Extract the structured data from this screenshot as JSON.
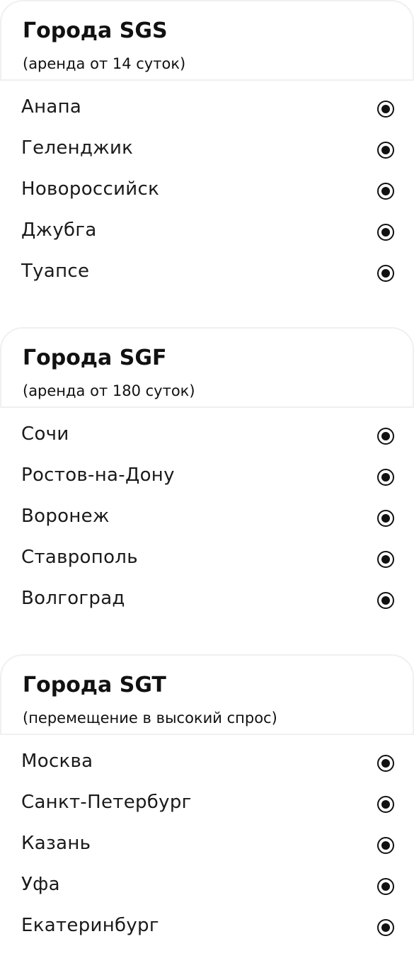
{
  "sections": [
    {
      "title": "Города SGS",
      "subtitle": "(аренда от 14 суток)",
      "cities": [
        "Анапа",
        "Геленджик",
        "Новороссийск",
        "Джубга",
        "Туапсе"
      ]
    },
    {
      "title": "Города SGF",
      "subtitle": "(аренда от 180 суток)",
      "cities": [
        "Сочи",
        "Ростов-на-Дону",
        "Воронеж",
        "Ставрополь",
        "Волгоград"
      ]
    },
    {
      "title": "Города SGT",
      "subtitle": "(перемещение в высокий спрос)",
      "cities": [
        "Москва",
        "Санкт-Петербург",
        "Казань",
        "Уфа",
        "Екатеринбург"
      ]
    }
  ],
  "radio_state": "selected",
  "colors": {
    "text": "#111111",
    "border": "#f0f0f0",
    "background": "#ffffff"
  }
}
